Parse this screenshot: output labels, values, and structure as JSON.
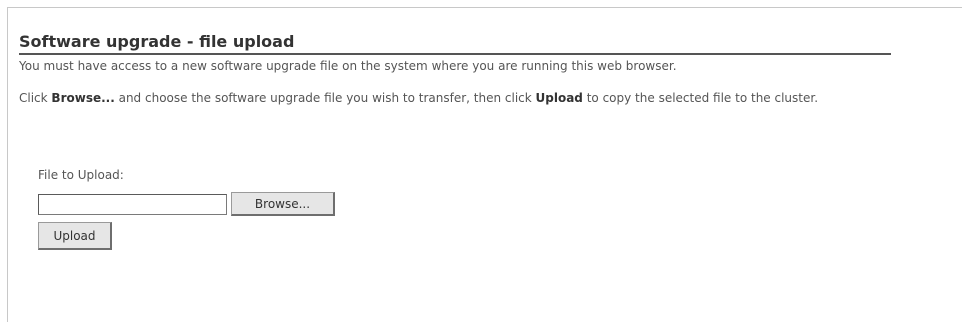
{
  "header": {
    "title": "Software upgrade - file upload"
  },
  "intro": {
    "text": "You must have access to a new software upgrade file on the system where you are running this web browser."
  },
  "instructions": {
    "part1": "Click ",
    "browse_word": "Browse...",
    "part2": " and choose the software upgrade file you wish to transfer, then click ",
    "upload_word": "Upload",
    "part3": " to copy the selected file to the cluster."
  },
  "form": {
    "file_label": "File to Upload:",
    "file_value": "",
    "browse_label": "Browse...",
    "upload_label": "Upload"
  },
  "colors": {
    "title_rule": "#555555",
    "text": "#555555",
    "button_face": "#e6e6e6"
  }
}
